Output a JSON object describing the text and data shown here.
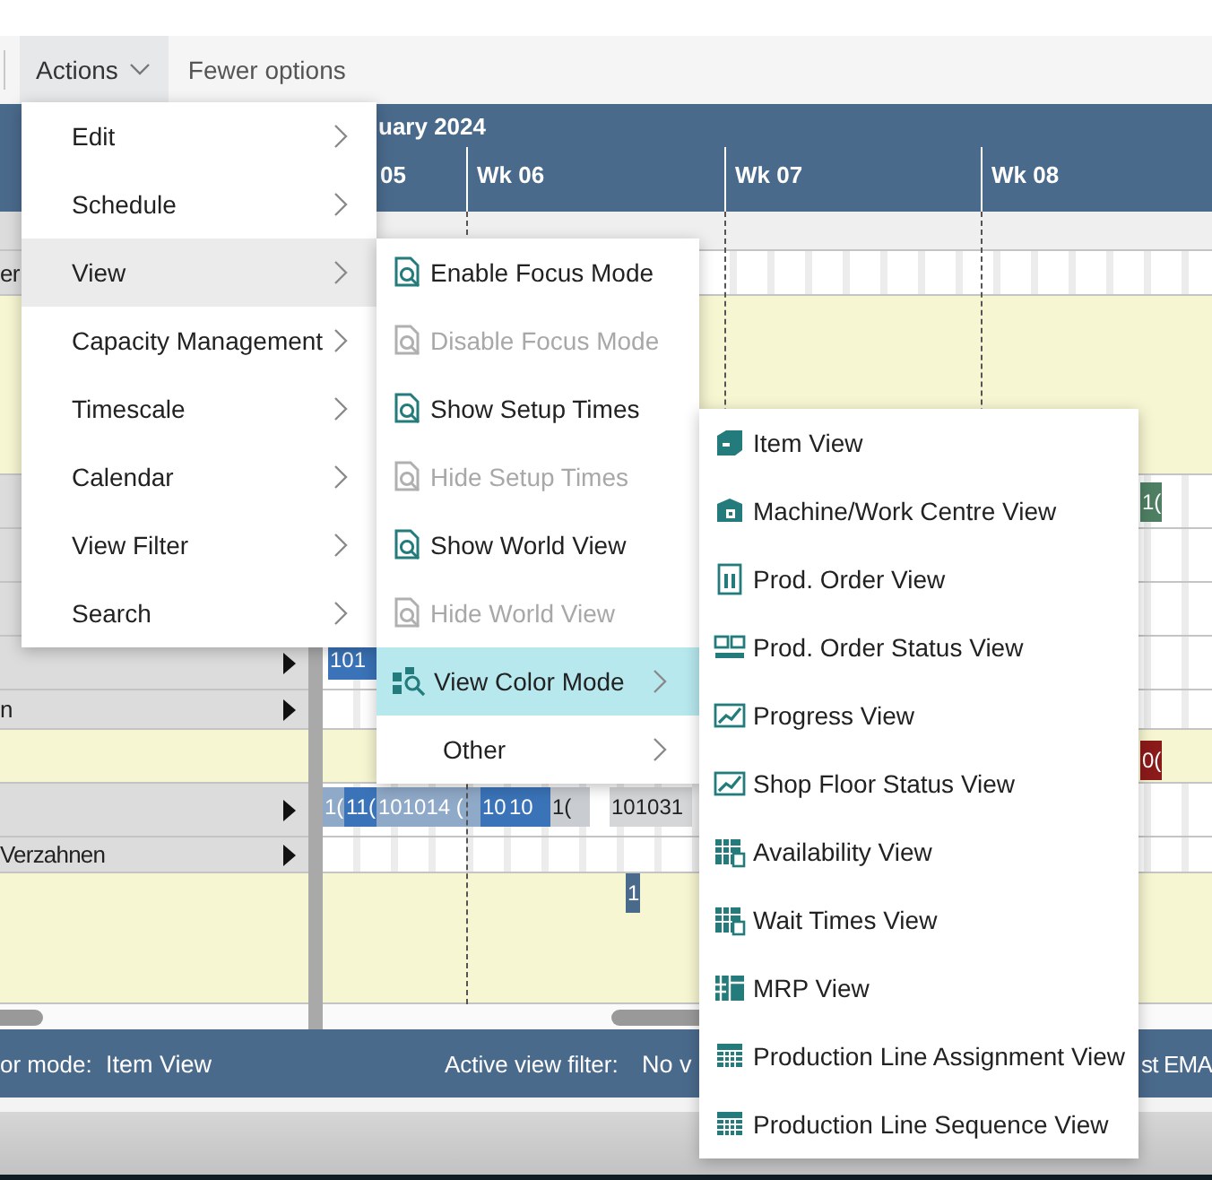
{
  "toolbar": {
    "actions_button": "Actions",
    "fewer_options": "Fewer options"
  },
  "gantt_header": {
    "month": "uary 2024",
    "weeks": [
      "05",
      "Wk 06",
      "Wk 07",
      "Wk 08"
    ]
  },
  "rows": [
    {
      "kind": "spacer",
      "bars": []
    },
    {
      "kind": "resource",
      "label": "er",
      "bars": []
    },
    {
      "kind": "load",
      "bars": []
    },
    {
      "kind": "resource",
      "bars": [
        {
          "label": "1(",
          "color": "#4e7f63"
        }
      ]
    },
    {
      "kind": "resource",
      "bars": []
    },
    {
      "kind": "resource",
      "bars": []
    },
    {
      "kind": "resource",
      "expandable": true,
      "bars": [
        {
          "label": "101",
          "color": "#3a73b8"
        }
      ]
    },
    {
      "kind": "resource",
      "label": "n",
      "expandable": true,
      "bars": []
    },
    {
      "kind": "load",
      "bars": [
        {
          "label": "0(",
          "color": "#8b1a1a"
        }
      ]
    },
    {
      "kind": "resource",
      "expandable": true,
      "bars": [
        {
          "label": "1(",
          "color": "#8fa9c8"
        },
        {
          "label": "11(",
          "color": "#3a73b8"
        },
        {
          "label": "101014 (",
          "color": "#8fa9c8"
        },
        {
          "label": "10",
          "color": "#3a73b8"
        },
        {
          "label": "10",
          "color": "#3a73b8"
        },
        {
          "label": "1(",
          "color": "#c9cdd2"
        },
        {
          "label": "101031",
          "color": "#d4d6d8"
        }
      ]
    },
    {
      "kind": "resource",
      "label": "Verzahnen",
      "expandable": true,
      "bars": []
    },
    {
      "kind": "load",
      "bars": [
        {
          "label": "1",
          "color": "#4a6a8c"
        }
      ]
    }
  ],
  "status_bar": [
    {
      "kind": "label",
      "text": "or mode:"
    },
    {
      "kind": "value",
      "text": "Item View"
    },
    {
      "kind": "label",
      "text": "Active view filter:"
    },
    {
      "kind": "value",
      "text": "No v"
    },
    {
      "kind": "value",
      "text": "st EMA"
    }
  ],
  "actions_menu": [
    {
      "label": "Edit",
      "selected": false
    },
    {
      "label": "Schedule",
      "selected": false
    },
    {
      "label": "View",
      "selected": true
    },
    {
      "label": "Capacity Management",
      "selected": false
    },
    {
      "label": "Timescale",
      "selected": false
    },
    {
      "label": "Calendar",
      "selected": false
    },
    {
      "label": "View Filter",
      "selected": false
    },
    {
      "label": "Search",
      "selected": false
    }
  ],
  "view_menu": [
    {
      "kind": "action",
      "label": "Enable Focus Mode",
      "disabled": false,
      "selected": false
    },
    {
      "kind": "action",
      "label": "Disable Focus Mode",
      "disabled": true,
      "selected": false
    },
    {
      "kind": "action",
      "label": "Show Setup Times",
      "disabled": false,
      "selected": false
    },
    {
      "kind": "action",
      "label": "Hide Setup Times",
      "disabled": true,
      "selected": false
    },
    {
      "kind": "action",
      "label": "Show World View",
      "disabled": false,
      "selected": false
    },
    {
      "kind": "action",
      "label": "Hide World View",
      "disabled": true,
      "selected": false
    },
    {
      "kind": "submenu",
      "label": "View Color Mode",
      "disabled": false,
      "selected": true
    },
    {
      "kind": "submenu",
      "label": "Other",
      "disabled": false,
      "selected": false
    }
  ],
  "color_mode_menu": [
    {
      "label": "Item View"
    },
    {
      "label": "Machine/Work Centre View"
    },
    {
      "label": "Prod. Order View"
    },
    {
      "label": "Prod. Order Status View"
    },
    {
      "label": "Progress View"
    },
    {
      "label": "Shop Floor Status View"
    },
    {
      "label": "Availability View"
    },
    {
      "label": "Wait Times View"
    },
    {
      "label": "MRP View"
    },
    {
      "label": "Production Line Assignment View"
    },
    {
      "label": "Production Line Sequence View"
    }
  ]
}
